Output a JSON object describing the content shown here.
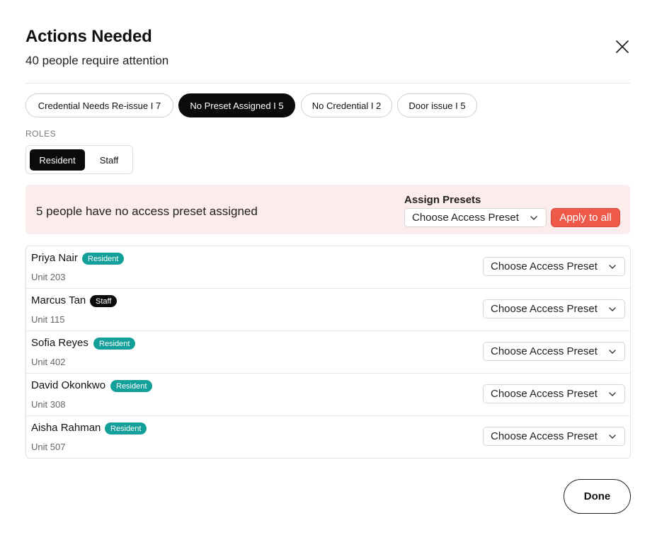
{
  "header": {
    "title": "Actions Needed",
    "subtitle": "40 people require attention"
  },
  "tabs": [
    {
      "label": "Credential Needs Re-issue I 7",
      "active": false
    },
    {
      "label": "No Preset Assigned I 5",
      "active": true
    },
    {
      "label": "No Credential I 2",
      "active": false
    },
    {
      "label": "Door issue I 5",
      "active": false
    }
  ],
  "roles": {
    "label": "ROLES",
    "options": [
      "Resident",
      "Staff"
    ],
    "selected": "Resident"
  },
  "banner": {
    "message": "5 people have no access preset assigned",
    "assign_label": "Assign Presets",
    "select_value": "Choose Access Preset",
    "apply_label": "Apply to all"
  },
  "people": [
    {
      "name": "Priya Nair",
      "role": "Resident",
      "unit": "Unit 203",
      "preset": "Choose Access Preset"
    },
    {
      "name": "Marcus Tan",
      "role": "Staff",
      "unit": "Unit 115",
      "preset": "Choose Access Preset"
    },
    {
      "name": "Sofia Reyes",
      "role": "Resident",
      "unit": "Unit 402",
      "preset": "Choose Access Preset"
    },
    {
      "name": "David Okonkwo",
      "role": "Resident",
      "unit": "Unit 308",
      "preset": "Choose Access Preset"
    },
    {
      "name": "Aisha Rahman",
      "role": "Resident",
      "unit": "Unit 507",
      "preset": "Choose Access Preset"
    }
  ],
  "footer": {
    "done_label": "Done"
  },
  "colors": {
    "accent_red": "#ee5a4a",
    "banner_bg": "#fdecec",
    "resident_badge": "#14a09a",
    "staff_badge": "#0b0b0b"
  },
  "icons": {
    "close": "close-icon",
    "dropdown": "chevron-down-icon"
  }
}
